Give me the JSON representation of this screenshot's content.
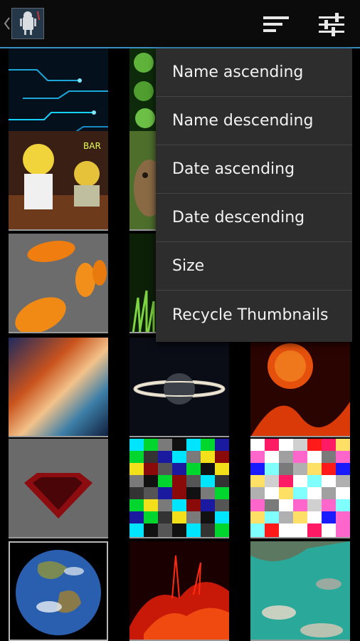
{
  "action_bar": {
    "up_icon": "chevron-left-icon",
    "app_icon": "android-app-icon",
    "sort_icon": "sort-lines-icon",
    "settings_icon": "sliders-icon",
    "accent_color": "#3a8fc2"
  },
  "sort_menu": {
    "items": [
      {
        "label": "Name ascending"
      },
      {
        "label": "Name descending"
      },
      {
        "label": "Date ascending"
      },
      {
        "label": "Date descending"
      },
      {
        "label": "Size"
      },
      {
        "label": "Recycle Thumbnails"
      }
    ]
  },
  "grid": {
    "thumbnails": [
      {
        "subject": "blue circuit lines"
      },
      {
        "subject": "green cells"
      },
      {
        "subject": "cartoon bar scene"
      },
      {
        "subject": "owl"
      },
      {
        "subject": "orange paw logo"
      },
      {
        "subject": "green grass"
      },
      {
        "subject": "abstract color streaks"
      },
      {
        "subject": "ringed planet"
      },
      {
        "subject": "sun flare"
      },
      {
        "subject": "superman logo"
      },
      {
        "subject": "dark color test pattern"
      },
      {
        "subject": "light color test pattern"
      },
      {
        "subject": "earth globe"
      },
      {
        "subject": "red solar flare"
      },
      {
        "subject": "turquoise river"
      }
    ]
  }
}
